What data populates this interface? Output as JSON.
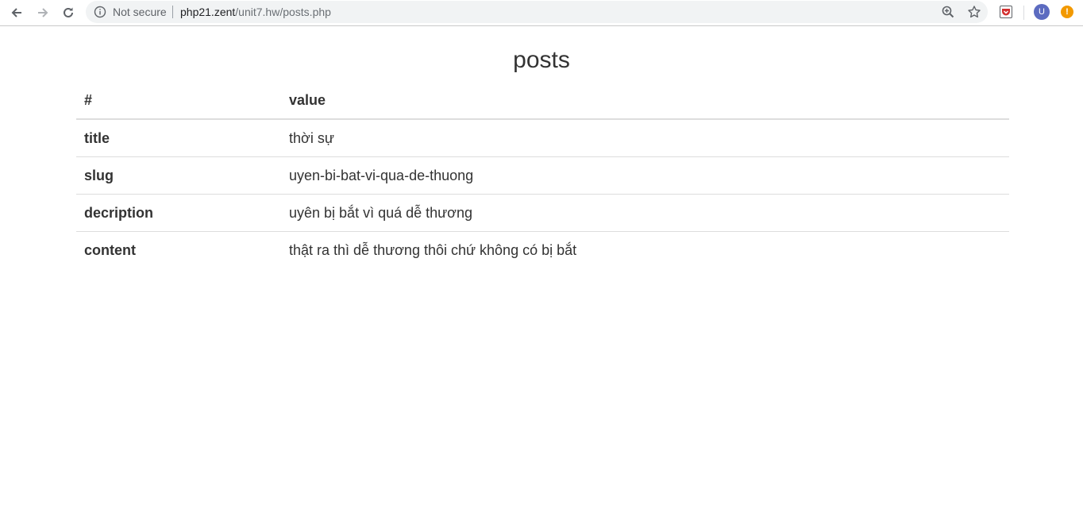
{
  "browser": {
    "security_label": "Not secure",
    "url_host": "php21.zent",
    "url_path": "/unit7.hw/posts.php",
    "avatar_letter": "U",
    "update_badge": "!",
    "icons": [
      "back-arrow-icon",
      "forward-arrow-icon",
      "reload-icon",
      "info-icon",
      "zoom-icon",
      "star-icon",
      "pocket-extension-icon"
    ],
    "colors": {
      "avatar": "#5c6bc0",
      "update_badge": "#f29900"
    }
  },
  "page": {
    "title": "posts",
    "table": {
      "headers": [
        "#",
        "value"
      ],
      "rows": [
        {
          "key": "title",
          "value": "thời sự"
        },
        {
          "key": "slug",
          "value": "uyen-bi-bat-vi-qua-de-thuong"
        },
        {
          "key": "decription",
          "value": "uyên bị bắt vì quá dễ thương"
        },
        {
          "key": "content",
          "value": "thật ra thì dễ thương thôi chứ không có bị bắt"
        }
      ]
    }
  }
}
